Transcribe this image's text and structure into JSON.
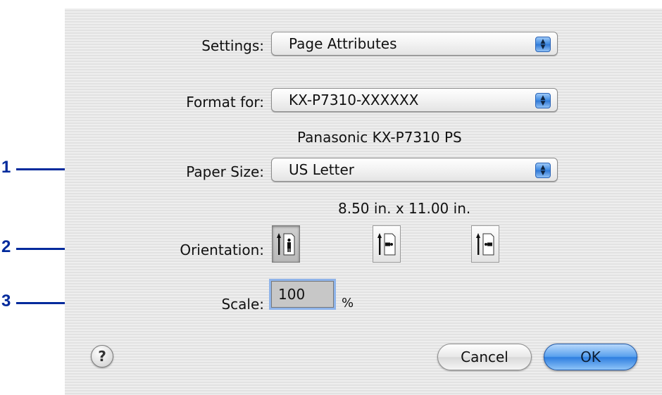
{
  "settings": {
    "label": "Settings:",
    "value": "Page Attributes"
  },
  "format_for": {
    "label": "Format for:",
    "value": "KX-P7310-XXXXXX",
    "printer_desc": "Panasonic KX-P7310 PS"
  },
  "paper_size": {
    "label": "Paper Size:",
    "value": "US Letter",
    "dimensions": "8.50 in. x 11.00 in."
  },
  "orientation": {
    "label": "Orientation:",
    "options": [
      {
        "name": "Portrait",
        "selected": true
      },
      {
        "name": "Landscape",
        "selected": false
      },
      {
        "name": "Reverse Landscape",
        "selected": false
      }
    ]
  },
  "scale": {
    "label": "Scale:",
    "value": "100",
    "unit": "%"
  },
  "buttons": {
    "help": "?",
    "cancel": "Cancel",
    "ok": "OK"
  },
  "callouts": [
    "1",
    "2",
    "3"
  ],
  "colors": {
    "callout": "#002a9c",
    "ok_button": "#3a86e0",
    "popup_arrows": "#3a86e0"
  },
  "icons": {
    "popup_arrows": "up-down-arrows-icon",
    "help": "question-mark-icon"
  }
}
